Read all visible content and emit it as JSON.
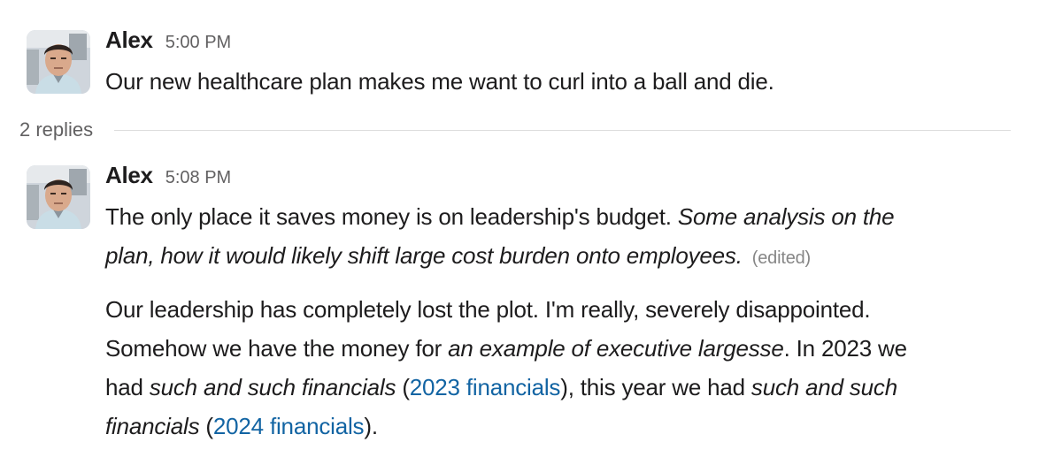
{
  "messages": [
    {
      "author": "Alex",
      "time": "5:00 PM",
      "text": "Our new healthcare plan makes me want to curl into a ball and die."
    },
    {
      "author": "Alex",
      "time": "5:08 PM",
      "para1": {
        "line1_plain": "The only place it saves money is on leadership's budget.  ",
        "line1_italic": "Some analysis on the",
        "line2_italic": "plan, how it would likely shift large cost burden onto employees.",
        "edited": "(edited)"
      },
      "para2": {
        "line1": "Our leadership has completely lost the plot. I'm really, severely disappointed.",
        "line2_plain_a": "Somehow we have the money for ",
        "line2_italic": "an example of executive largesse",
        "line2_plain_b": ".  In 2023 we",
        "line3_plain_a": "had ",
        "line3_italic": "such and such financials",
        "line3_plain_b": " (",
        "line3_link": "2023 financials",
        "line3_plain_c": "), this year we had ",
        "line3_italic_b": "such and such",
        "line4_italic": "financials",
        "line4_plain_a": " (",
        "line4_link": "2024 financials",
        "line4_plain_b": ")."
      }
    }
  ],
  "thread": {
    "replies_label": "2 replies"
  },
  "colors": {
    "text": "#1d1c1d",
    "muted": "#616061",
    "edited": "#868686",
    "link": "#1264a3",
    "divider": "#dddddd"
  },
  "icons": {
    "avatar": "user-avatar-photo"
  }
}
